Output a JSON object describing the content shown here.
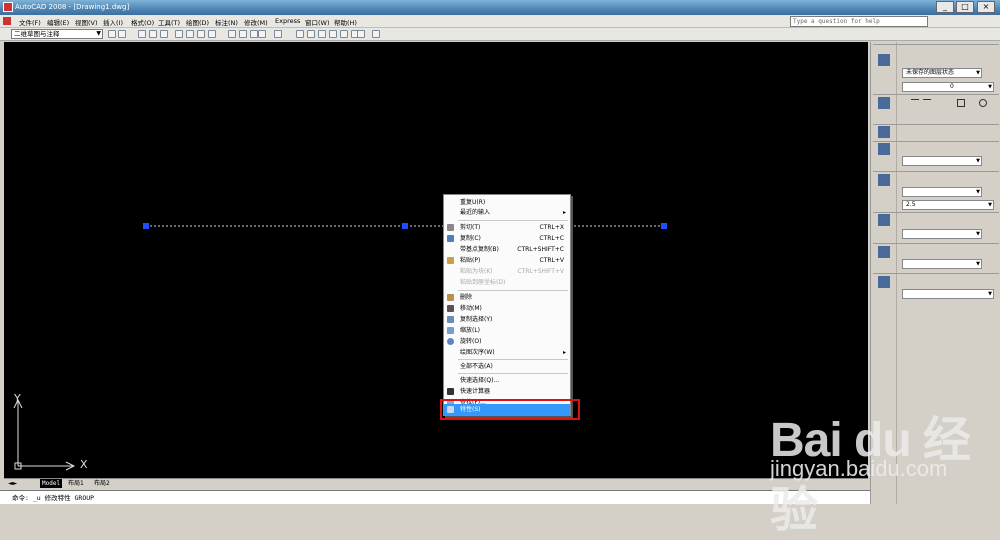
{
  "window": {
    "title": "AutoCAD 2008 - [Drawing1.dwg]",
    "help_placeholder": "Type a question for help"
  },
  "menubar": [
    "文件(F)",
    "编辑(E)",
    "视图(V)",
    "插入(I)",
    "格式(O)",
    "工具(T)",
    "绘图(D)",
    "标注(N)",
    "修改(M)",
    "Express",
    "窗口(W)",
    "帮助(H)"
  ],
  "toolbar": {
    "workspace": "二维草图与注释"
  },
  "context_menu": {
    "items": [
      {
        "label": "重复U(R)",
        "shortcut": "",
        "submenu": false,
        "disabled": false
      },
      {
        "label": "最近的输入",
        "shortcut": "",
        "submenu": true,
        "disabled": false
      },
      {
        "label": "剪切(T)",
        "shortcut": "CTRL+X",
        "submenu": false,
        "disabled": false,
        "icon": "scissors-icon"
      },
      {
        "label": "复制(C)",
        "shortcut": "CTRL+C",
        "submenu": false,
        "disabled": false,
        "icon": "copy-icon"
      },
      {
        "label": "带基点复制(B)",
        "shortcut": "CTRL+SHIFT+C",
        "submenu": false,
        "disabled": false
      },
      {
        "label": "粘贴(P)",
        "shortcut": "CTRL+V",
        "submenu": false,
        "disabled": false,
        "icon": "paste-icon"
      },
      {
        "label": "粘贴为块(K)",
        "shortcut": "CTRL+SHIFT+V",
        "submenu": false,
        "disabled": true
      },
      {
        "label": "粘贴到原坐标(D)",
        "shortcut": "",
        "submenu": false,
        "disabled": true
      },
      {
        "label": "删除",
        "shortcut": "",
        "submenu": false,
        "disabled": false,
        "icon": "erase-icon"
      },
      {
        "label": "移动(M)",
        "shortcut": "",
        "submenu": false,
        "disabled": false,
        "icon": "move-icon"
      },
      {
        "label": "复制选择(Y)",
        "shortcut": "",
        "submenu": false,
        "disabled": false,
        "icon": "copy-selection-icon"
      },
      {
        "label": "缩放(L)",
        "shortcut": "",
        "submenu": false,
        "disabled": false,
        "icon": "scale-icon"
      },
      {
        "label": "旋转(O)",
        "shortcut": "",
        "submenu": false,
        "disabled": false,
        "icon": "rotate-icon"
      },
      {
        "label": "绘图次序(W)",
        "shortcut": "",
        "submenu": true,
        "disabled": false
      },
      {
        "label": "全部不选(A)",
        "shortcut": "",
        "submenu": false,
        "disabled": false
      },
      {
        "label": "快速选择(Q)...",
        "shortcut": "",
        "submenu": false,
        "disabled": false
      },
      {
        "label": "快速计算器",
        "shortcut": "",
        "submenu": false,
        "disabled": false,
        "icon": "calculator-icon"
      },
      {
        "label": "查找(F)...",
        "shortcut": "",
        "submenu": false,
        "disabled": false,
        "icon": "find-icon"
      },
      {
        "label": "特性(S)",
        "shortcut": "",
        "submenu": false,
        "disabled": false,
        "highlighted": true,
        "icon": "properties-icon"
      }
    ]
  },
  "tabs": {
    "model": "Model",
    "layout1": "布局1",
    "layout2": "布局2"
  },
  "command": {
    "prefix": "命令:",
    "text": "_u 修改特性 GROUP"
  },
  "ucs": {
    "x": "X",
    "y": "Y"
  },
  "palette": {
    "layer_state": "未保存的图层状态",
    "layer": "0",
    "text_height": "2.5"
  },
  "watermark": {
    "logo": "Bai du 经验",
    "url": "jingyan.baidu.com"
  },
  "colors": {
    "canvas": "#000000",
    "grip": "#1f4fff",
    "highlight": "#3399ff",
    "marker": "#dd1111"
  }
}
